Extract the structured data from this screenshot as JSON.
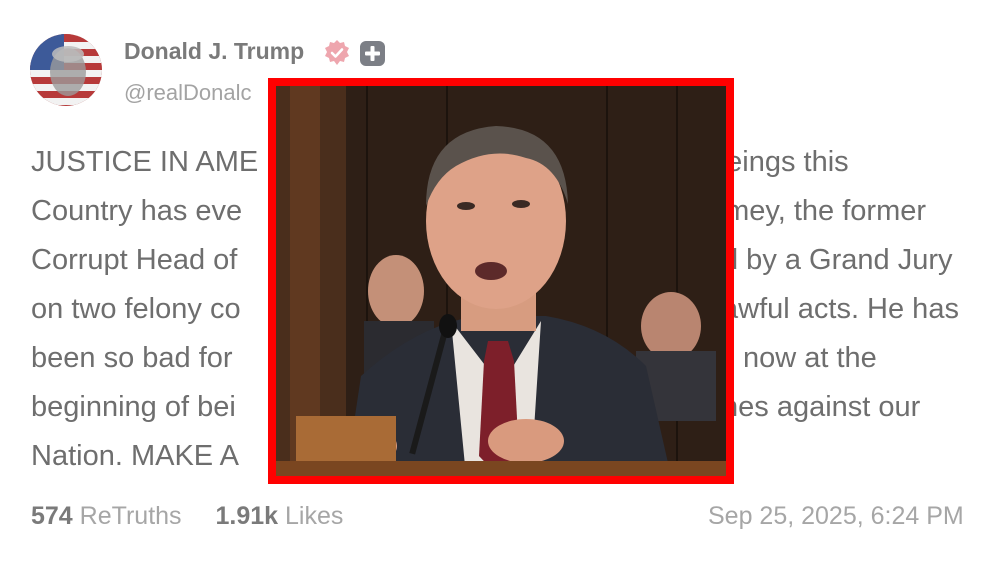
{
  "post": {
    "author": {
      "display_name": "Donald J. Trump",
      "handle": "@realDonalc",
      "verified_icon": "verified-badge-icon",
      "plus_icon": "plus-badge-icon"
    },
    "text_lines": [
      "JUSTICE IN AME                                              beings this",
      "Country has eve                                            omey, the former",
      "Corrupt Head of                                            d by a Grand Jury",
      "on two felony co                                           awful acts. He has",
      "been so bad for                                            now at the",
      "beginning of bei                                           nes against our",
      "Nation. MAKE A"
    ],
    "stats": {
      "retruths_count": "574",
      "retruths_label": "ReTruths",
      "likes_count": "1.91k",
      "likes_label": "Likes"
    },
    "timestamp": "Sep 25, 2025, 6:24 PM"
  },
  "overlay": {
    "border_color": "#ff0000",
    "image": "photo of a man in a suit and red tie speaking at a hearing microphone"
  },
  "colors": {
    "text": "#6e6e6e",
    "muted": "#a6a6a6",
    "verified": "#e8a0a8",
    "overlay_border": "#ff0000"
  }
}
